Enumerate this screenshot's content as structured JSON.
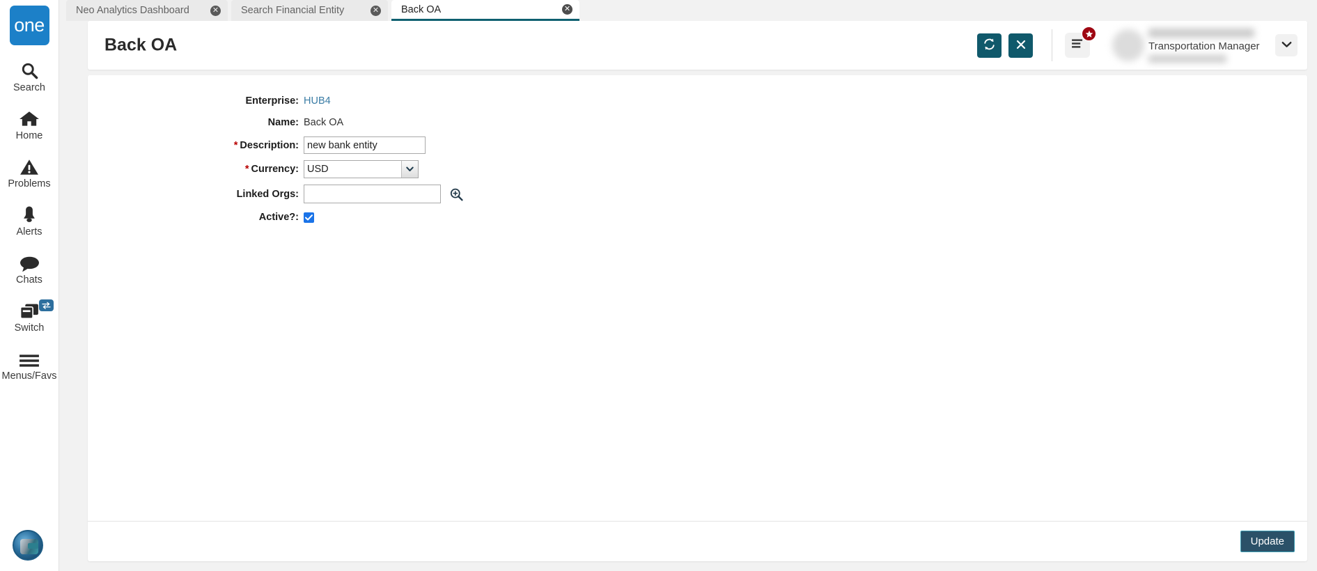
{
  "app": {
    "logo_text": "one"
  },
  "sidebar": {
    "items": [
      {
        "label": "Search",
        "icon": "search-icon"
      },
      {
        "label": "Home",
        "icon": "home-icon"
      },
      {
        "label": "Problems",
        "icon": "warning-triangle-icon"
      },
      {
        "label": "Alerts",
        "icon": "bell-icon"
      },
      {
        "label": "Chats",
        "icon": "chat-bubble-icon"
      },
      {
        "label": "Switch",
        "icon": "windows-stack-icon",
        "badge_icon": "swap-arrows-icon"
      },
      {
        "label": "Menus/Favs",
        "icon": "hamburger-icon"
      }
    ],
    "avatar_icon": "user-avatar-image"
  },
  "tabs": [
    {
      "label": "Neo Analytics Dashboard",
      "active": false,
      "close_icon": "close-circle-icon"
    },
    {
      "label": "Search Financial Entity",
      "active": false,
      "close_icon": "close-circle-icon"
    },
    {
      "label": "Back OA",
      "active": true,
      "close_icon": "close-circle-icon"
    }
  ],
  "header": {
    "title": "Back OA",
    "refresh_icon": "refresh-icon",
    "close_icon": "close-x-icon",
    "menu_icon": "menu-lines-icon",
    "menu_badge_icon": "star-icon",
    "caret_icon": "chevron-down-icon",
    "user_role": "Transportation Manager"
  },
  "form": {
    "fields": [
      {
        "name": "enterprise",
        "label": "Enterprise:",
        "required": false,
        "type": "link",
        "value": "HUB4"
      },
      {
        "name": "name",
        "label": "Name:",
        "required": false,
        "type": "text",
        "value": "Back OA"
      },
      {
        "name": "description",
        "label": "Description:",
        "required": true,
        "type": "input",
        "value": "new bank entity"
      },
      {
        "name": "currency",
        "label": "Currency:",
        "required": true,
        "type": "select",
        "value": "USD",
        "options": [
          "USD"
        ]
      },
      {
        "name": "linked_orgs",
        "label": "Linked Orgs:",
        "required": false,
        "type": "lookup",
        "value": "",
        "lookup_icon": "search-plus-icon"
      },
      {
        "name": "active",
        "label": "Active?:",
        "required": false,
        "type": "checkbox",
        "checked": true
      }
    ]
  },
  "footer": {
    "update_label": "Update"
  },
  "colors": {
    "accent_teal": "#10596b",
    "logo_blue": "#1c80c8",
    "badge_red": "#9e0712",
    "update_bg": "#2b5168",
    "update_border": "#3f9fb5",
    "link_blue": "#3a7ca5",
    "checkbox_blue": "#1a73e8",
    "required_red": "#b80000"
  }
}
